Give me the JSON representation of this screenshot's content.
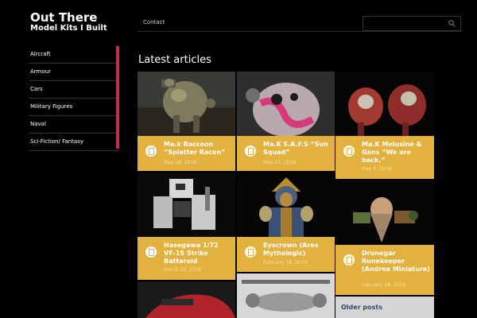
{
  "site": {
    "title": "Out There",
    "tagline": "Model Kits I Built"
  },
  "topnav": {
    "contact": "Contact"
  },
  "search": {
    "icon": "search-icon"
  },
  "sidebar": {
    "items": [
      {
        "label": "Aircraft"
      },
      {
        "label": "Armour"
      },
      {
        "label": "Cars"
      },
      {
        "label": "Military Figures"
      },
      {
        "label": "Naval"
      },
      {
        "label": "Sci-Fiction/ Fantasy"
      }
    ],
    "accent": "#c62f49"
  },
  "main": {
    "heading": "Latest articles",
    "accent": "#e2b13e",
    "articles": [
      {
        "title": "Ma.k Raccoon “Splatter Racon”",
        "date": "May 28, 2018"
      },
      {
        "title": "Ma.K S.A.F.S “Sun Squad”",
        "date": "May 27, 2018"
      },
      {
        "title": "Ma.K Melusine & Gans “We are back.”",
        "date": "May 5, 2018"
      },
      {
        "title": "Hasegawa 1/72 VF-1S Strike Battaroid",
        "date": "March 25, 2018"
      },
      {
        "title": "Eyscrown (Ares Mythologic)",
        "date": "February 18, 2018"
      },
      {
        "title": "Drunegar Runekeeper (Andrea Miniature)",
        "date": "February 18, 2018"
      }
    ],
    "older_posts": "Older posts"
  }
}
